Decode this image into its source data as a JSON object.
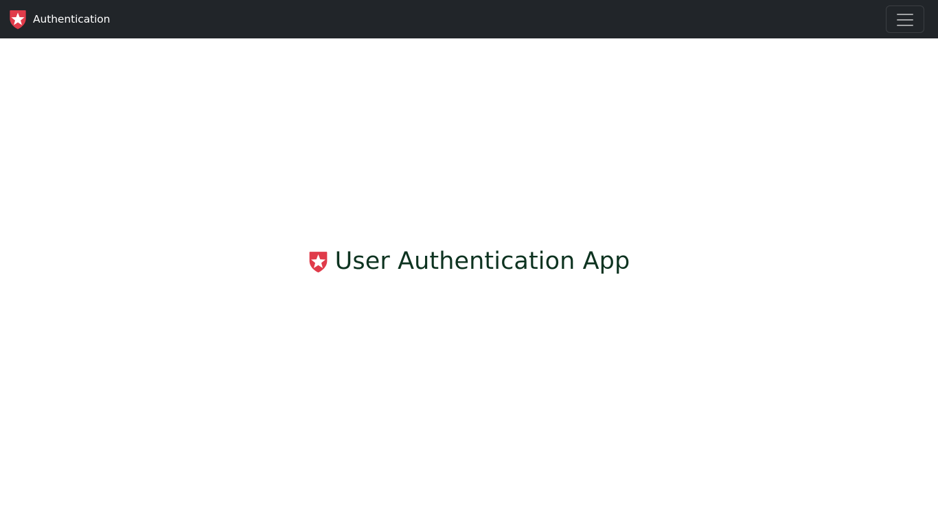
{
  "navbar": {
    "brand_label": "Authentication",
    "brand_icon": "shield-star-icon",
    "toggler_icon": "hamburger-menu-icon"
  },
  "main": {
    "title": "User Authentication App",
    "title_icon": "shield-star-icon"
  },
  "colors": {
    "navbar_bg": "#212529",
    "brand_accent": "#e03b4a",
    "title_text": "#0d3320",
    "page_bg": "#ffffff"
  }
}
